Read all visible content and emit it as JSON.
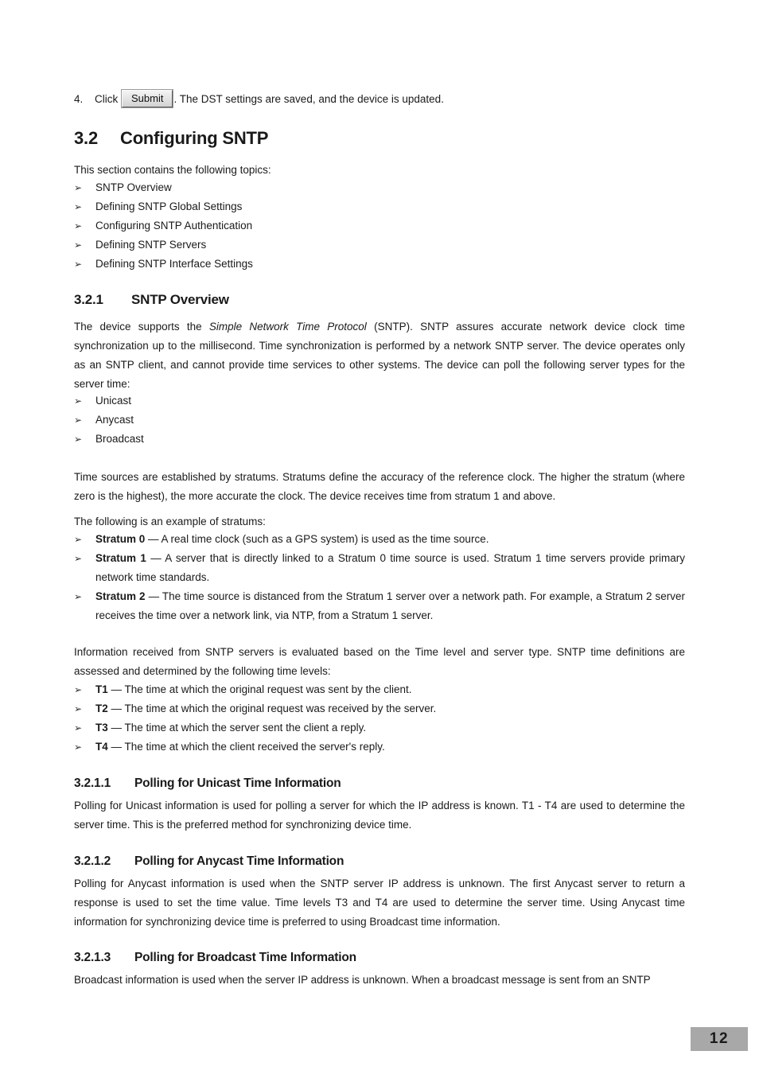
{
  "step": {
    "number": "4.",
    "click_label": "Click",
    "button_label": "Submit",
    "rest": ". The DST settings are saved, and the device is updated."
  },
  "section": {
    "number": "3.2",
    "title": "Configuring SNTP",
    "intro": "This section contains the following topics:",
    "topics": [
      "SNTP Overview",
      "Defining SNTP Global Settings",
      "Configuring SNTP Authentication",
      "Defining SNTP Servers",
      "Defining SNTP Interface Settings"
    ]
  },
  "overview": {
    "number": "3.2.1",
    "title": "SNTP Overview",
    "para1_a": "The device supports the ",
    "para1_italic": "Simple Network Time Protocol",
    "para1_b": " (SNTP). SNTP assures accurate network device clock time synchronization up to the millisecond. Time synchronization is performed by a network SNTP server. The device operates only as an SNTP client, and cannot provide time services to other systems. The device can poll the following server types for the server time:",
    "server_types": [
      "Unicast",
      "Anycast",
      "Broadcast"
    ],
    "para2": "Time sources are established by stratums. Stratums define the accuracy of the reference clock. The higher the stratum (where zero is the highest), the more accurate the clock. The device receives time from stratum 1 and above.",
    "para3": "The following is an example of stratums:",
    "stratums": [
      {
        "term": "Stratum 0",
        "dash": " — ",
        "text": "A real time clock (such as a GPS system) is used as the time source."
      },
      {
        "term": "Stratum 1",
        "dash": " — ",
        "text": "A server that is directly linked to a Stratum 0 time source is used. Stratum 1 time servers provide primary network time standards."
      },
      {
        "term": "Stratum 2",
        "dash": " — ",
        "text": "The time source is distanced from the Stratum 1 server over a network path. For example, a Stratum 2 server receives the time over a network link, via NTP, from a Stratum 1 server."
      }
    ],
    "para4": "Information received from SNTP servers is evaluated based on the Time level and server type. SNTP time definitions are assessed and determined by the following time levels:",
    "time_levels": [
      {
        "term": "T1",
        "dash": " — ",
        "text": "The time at which the original request was sent by the client."
      },
      {
        "term": "T2",
        "dash": " — ",
        "text": "The time at which the original request was received by the server."
      },
      {
        "term": "T3",
        "dash": " — ",
        "text": "The time at which the server sent the client a reply."
      },
      {
        "term": "T4",
        "dash": " — ",
        "text": "The time at which the client received the server's reply."
      }
    ]
  },
  "unicast": {
    "number": "3.2.1.1",
    "title": "Polling for Unicast Time Information",
    "body": "Polling for Unicast information is used for polling a server for which the IP address is known. T1 - T4 are used to determine the server time. This is the preferred method for synchronizing device time."
  },
  "anycast": {
    "number": "3.2.1.2",
    "title": "Polling for Anycast Time Information",
    "body": "Polling for Anycast information is used when the SNTP server IP address is unknown. The first Anycast server to return a response is used to set the time value. Time levels T3 and T4 are used to determine the server time. Using Anycast time information for synchronizing device time is preferred to using Broadcast time information."
  },
  "broadcast": {
    "number": "3.2.1.3",
    "title": "Polling for Broadcast Time Information",
    "body": "Broadcast information is used when the server IP address is unknown. When a broadcast message is sent from an SNTP"
  },
  "footer": {
    "page_number": "12",
    "box_color": "#a8a8a8"
  },
  "icons": {
    "bullet_arrow": "➢"
  }
}
